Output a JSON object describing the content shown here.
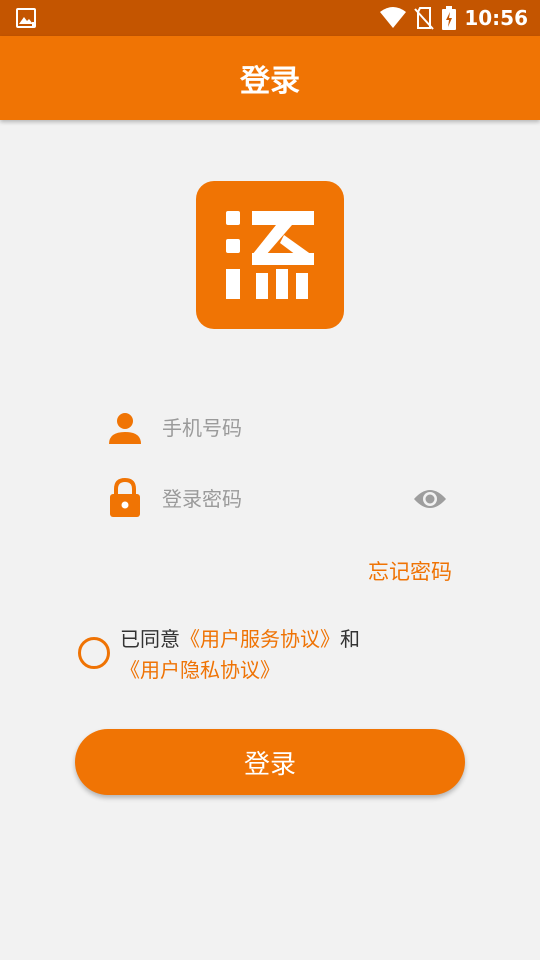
{
  "status_bar": {
    "time": "10:56",
    "icons": [
      "gallery-icon",
      "wifi-icon",
      "no-sim-icon",
      "battery-charging-icon"
    ]
  },
  "app_bar": {
    "title": "登录"
  },
  "logo": {
    "glyph": "添",
    "color": "#f07404"
  },
  "form": {
    "phone_placeholder": "手机号码",
    "phone_value": "",
    "password_placeholder": "登录密码",
    "password_value": "",
    "forgot_password": "忘记密码"
  },
  "agreement": {
    "prefix": "已同意",
    "service_link": "《用户服务协议》",
    "and": "和",
    "privacy_link": "《用户隐私协议》",
    "checked": false
  },
  "login_button": "登录",
  "colors": {
    "accent": "#f07404",
    "status_bar": "#c45500",
    "background": "#f2f2f2",
    "placeholder": "#9a9a9a",
    "eye_icon": "#9e9e9e"
  }
}
